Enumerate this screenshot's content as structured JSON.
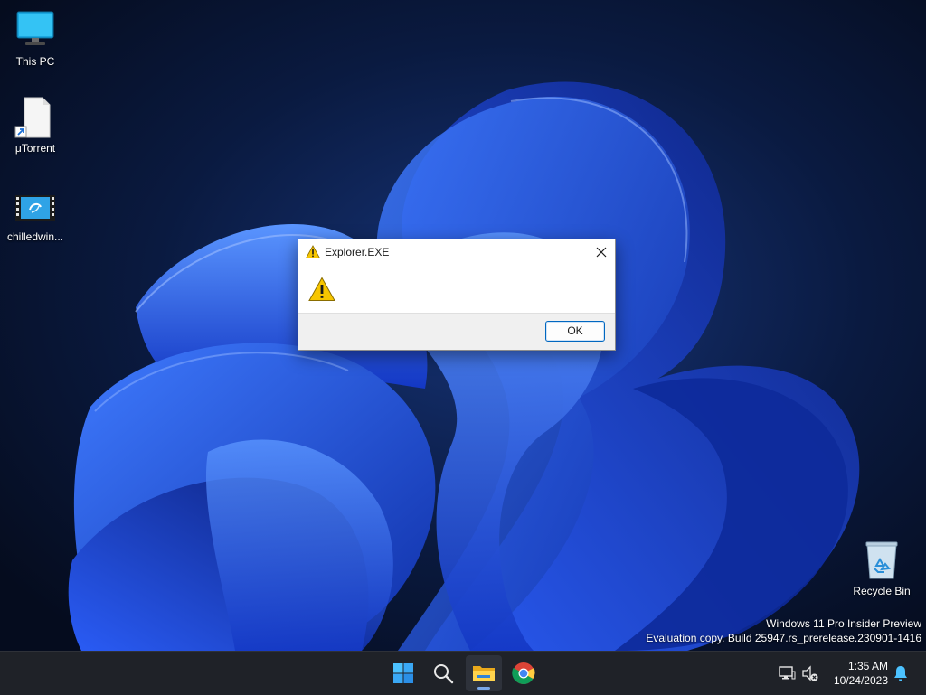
{
  "desktop": {
    "icons": [
      {
        "label": "This PC",
        "icon": "monitor-icon"
      },
      {
        "label": "μTorrent",
        "icon": "shortcut-file-icon"
      },
      {
        "label": "chilledwin...",
        "icon": "video-file-icon"
      },
      {
        "label": "Recycle Bin",
        "icon": "recycle-bin-icon"
      }
    ],
    "watermark": {
      "line1": "Windows 11 Pro Insider Preview",
      "line2": "Evaluation copy. Build 25947.rs_prerelease.230901-1416"
    }
  },
  "dialog": {
    "title": "Explorer.EXE",
    "message": "",
    "ok_label": "OK",
    "icon": "warning-icon",
    "close_icon": "close-icon"
  },
  "taskbar": {
    "apps": [
      {
        "name": "Start",
        "icon": "windows-start-icon"
      },
      {
        "name": "Search",
        "icon": "search-icon"
      },
      {
        "name": "File Explorer",
        "icon": "folder-icon",
        "active": true
      },
      {
        "name": "Google Chrome",
        "icon": "chrome-icon"
      }
    ],
    "tray": {
      "time": "1:35 AM",
      "date": "10/24/2023",
      "icons": [
        "network-icon",
        "volume-muted-icon",
        "notification-bell-icon"
      ]
    }
  },
  "colors": {
    "accent": "#0067c0",
    "taskbar": "#1f2228",
    "warning": "#f7c600"
  }
}
